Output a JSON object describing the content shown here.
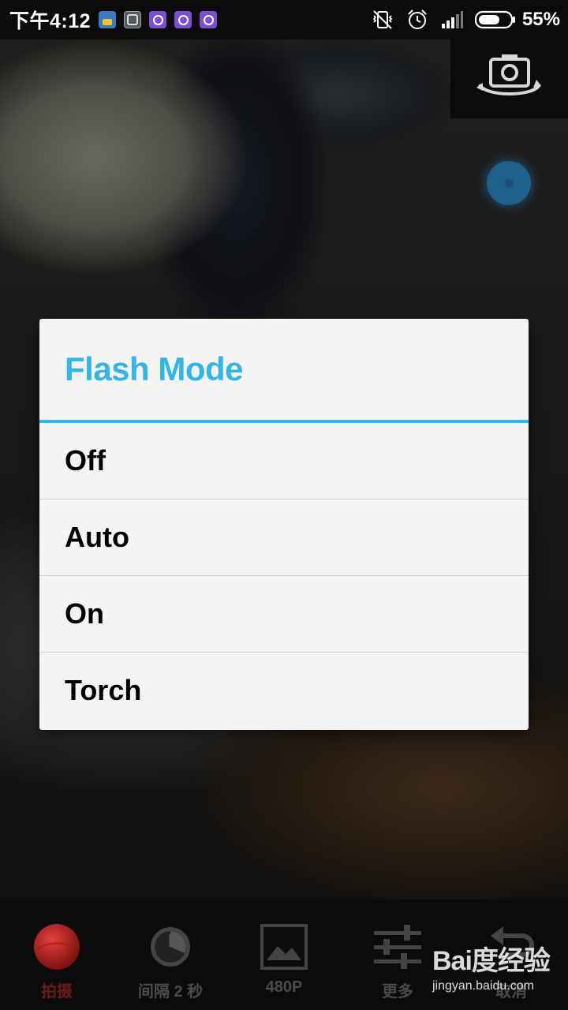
{
  "status_bar": {
    "time": "下午4:12",
    "notification_icons": [
      "cleaner-icon",
      "app-box-icon",
      "app-purple-icon",
      "app-purple-icon",
      "app-purple-icon"
    ],
    "system_icons": [
      "vibrate-off-icon",
      "alarm-icon",
      "signal-icon",
      "battery-icon"
    ],
    "battery_percent": "55%"
  },
  "camera": {
    "switch_icon": "camera-switch-icon"
  },
  "dialog": {
    "title": "Flash Mode",
    "options": [
      {
        "label": "Off"
      },
      {
        "label": "Auto"
      },
      {
        "label": "On"
      },
      {
        "label": "Torch"
      }
    ]
  },
  "toolbar": {
    "items": [
      {
        "label": "拍摄",
        "icon": "record-icon"
      },
      {
        "label": "间隔 2 秒",
        "icon": "clock-icon"
      },
      {
        "label": "480P",
        "icon": "image-icon"
      },
      {
        "label": "更多",
        "icon": "sliders-icon"
      },
      {
        "label": "取消",
        "icon": "undo-icon"
      }
    ]
  },
  "watermark": {
    "logo": "Bai度经验",
    "url": "jingyan.baidu.com"
  },
  "colors": {
    "accent": "#33b5e5",
    "dialog_bg": "#f4f4f4",
    "record_red": "#d0231f"
  }
}
